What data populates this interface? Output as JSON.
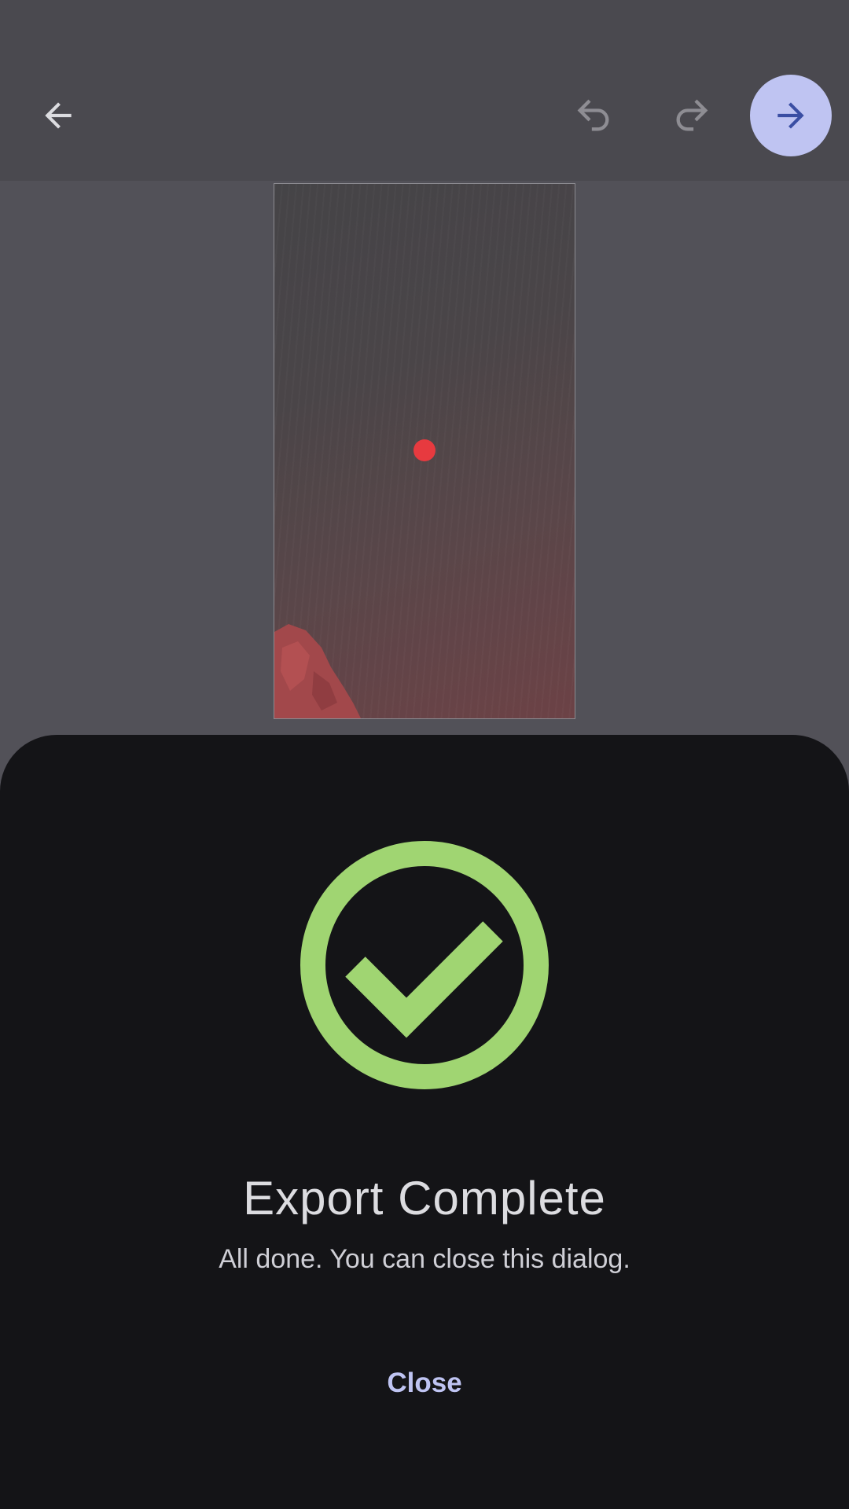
{
  "toolbar": {
    "back_icon": "arrow-left-icon",
    "undo_icon": "undo-icon",
    "redo_icon": "redo-icon",
    "next_icon": "arrow-right-icon"
  },
  "dialog": {
    "icon": "check-circle-icon",
    "title": "Export Complete",
    "message": "All done. You can close this dialog.",
    "close_label": "Close"
  },
  "colors": {
    "accent": "#bfc4f2",
    "success": "#a0d572",
    "marker": "#e73a3f",
    "sheet_background": "#141417"
  }
}
